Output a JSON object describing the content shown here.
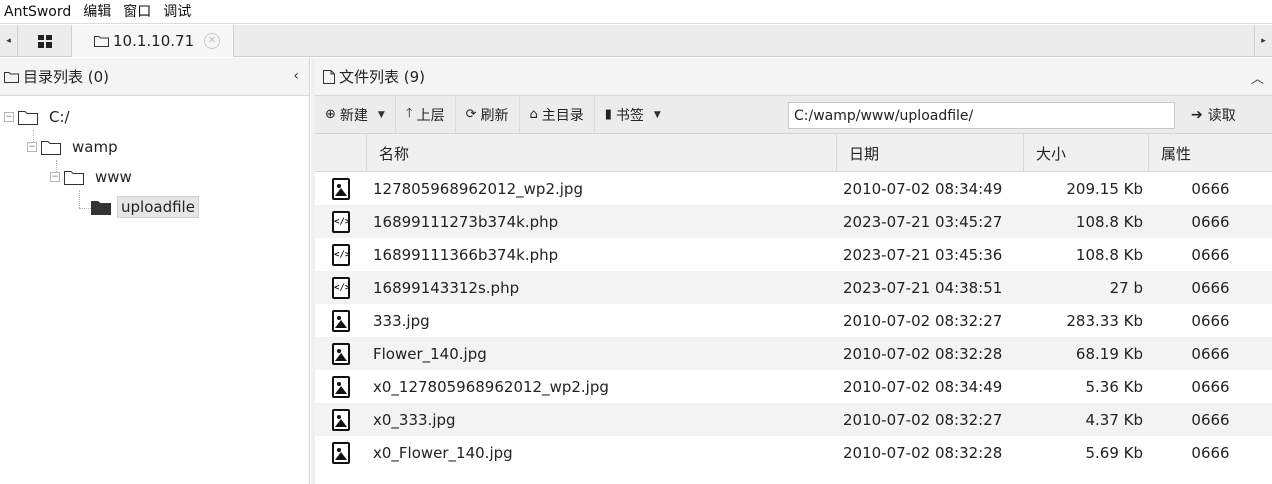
{
  "menubar": {
    "items": [
      "AntSword",
      "编辑",
      "窗口",
      "调试"
    ]
  },
  "tabs": {
    "scroll_left": "◂",
    "scroll_right": "▸",
    "home_icon": "grid-icon",
    "shell_tab_label": "10.1.10.71",
    "shell_tab_close": "✕"
  },
  "dir_panel": {
    "title": "目录列表 (0)",
    "collapse": "‹",
    "tree": [
      {
        "label": "C:/"
      },
      {
        "label": "wamp"
      },
      {
        "label": "www"
      },
      {
        "label": "uploadfile"
      }
    ]
  },
  "file_panel": {
    "title": "文件列表 (9)",
    "toolbar": {
      "new_label": "新建",
      "up_label": "上层",
      "refresh_label": "刷新",
      "home_label": "主目录",
      "bookmark_label": "书签",
      "path_value": "C:/wamp/www/uploadfile/",
      "read_label": "读取"
    },
    "columns": [
      "名称",
      "日期",
      "大小",
      "属性"
    ],
    "files": [
      {
        "type": "image",
        "name": "127805968962012_wp2.jpg",
        "date": "2010-07-02 08:34:49",
        "size": "209.15 Kb",
        "attr": "0666"
      },
      {
        "type": "code",
        "name": "16899111273b374k.php",
        "date": "2023-07-21 03:45:27",
        "size": "108.8 Kb",
        "attr": "0666"
      },
      {
        "type": "code",
        "name": "16899111366b374k.php",
        "date": "2023-07-21 03:45:36",
        "size": "108.8 Kb",
        "attr": "0666"
      },
      {
        "type": "code",
        "name": "16899143312s.php",
        "date": "2023-07-21 04:38:51",
        "size": "27 b",
        "attr": "0666"
      },
      {
        "type": "image",
        "name": "333.jpg",
        "date": "2010-07-02 08:32:27",
        "size": "283.33 Kb",
        "attr": "0666"
      },
      {
        "type": "image",
        "name": "Flower_140.jpg",
        "date": "2010-07-02 08:32:28",
        "size": "68.19 Kb",
        "attr": "0666"
      },
      {
        "type": "image",
        "name": "x0_127805968962012_wp2.jpg",
        "date": "2010-07-02 08:34:49",
        "size": "5.36 Kb",
        "attr": "0666"
      },
      {
        "type": "image",
        "name": "x0_333.jpg",
        "date": "2010-07-02 08:32:27",
        "size": "4.37 Kb",
        "attr": "0666"
      },
      {
        "type": "image",
        "name": "x0_Flower_140.jpg",
        "date": "2010-07-02 08:32:28",
        "size": "5.69 Kb",
        "attr": "0666"
      }
    ]
  }
}
